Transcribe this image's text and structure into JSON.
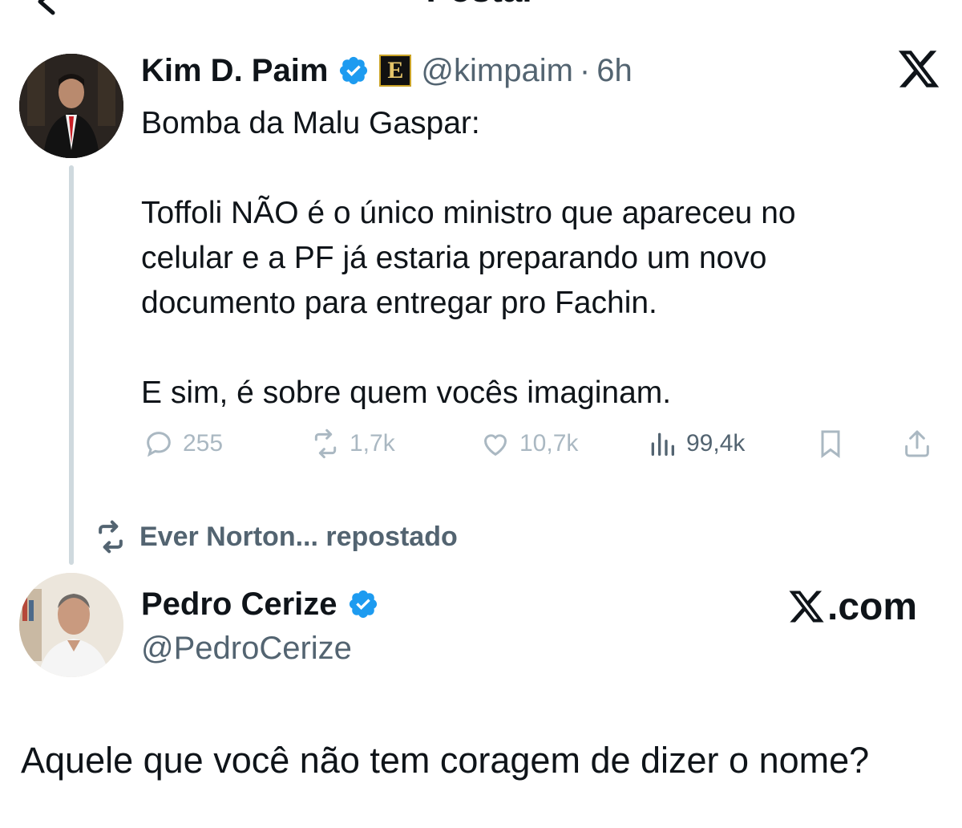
{
  "header": {
    "title": "Postar"
  },
  "tweet": {
    "author_name": "Kim D. Paim",
    "handle": "@kimpaim",
    "separator": "·",
    "time": "6h",
    "badge_letter": "E",
    "lines": [
      "Bomba da Malu Gaspar:",
      "",
      "Toffoli NÃO é o único ministro que apareceu no",
      "celular e a PF já estaria preparando um novo",
      "documento para entregar pro Fachin.",
      "",
      "E sim, é sobre quem vocês imaginam."
    ],
    "stats": {
      "replies": "255",
      "reposts": "1,7k",
      "likes": "10,7k",
      "views": "99,4k"
    }
  },
  "repost": {
    "label": "Ever Norton... repostado"
  },
  "quote_user": {
    "name": "Pedro Cerize",
    "handle": "@PedroCerize",
    "site_suffix": ".com"
  },
  "caption": "Aquele que você não tem coragem de dizer o nome?",
  "colors": {
    "verified": "#1d9bf0",
    "text": "#0f1419",
    "muted": "#536471",
    "faded_icons": "#aab8c2",
    "thread_line": "#cfd9de"
  },
  "icons": {
    "back": "arrow-left-icon",
    "verified": "verified-badge-icon",
    "x": "x-logo-icon",
    "reply": "reply-icon",
    "retweet": "retweet-icon",
    "like": "heart-icon",
    "views": "views-icon",
    "bookmark": "bookmark-icon",
    "share": "share-icon"
  }
}
